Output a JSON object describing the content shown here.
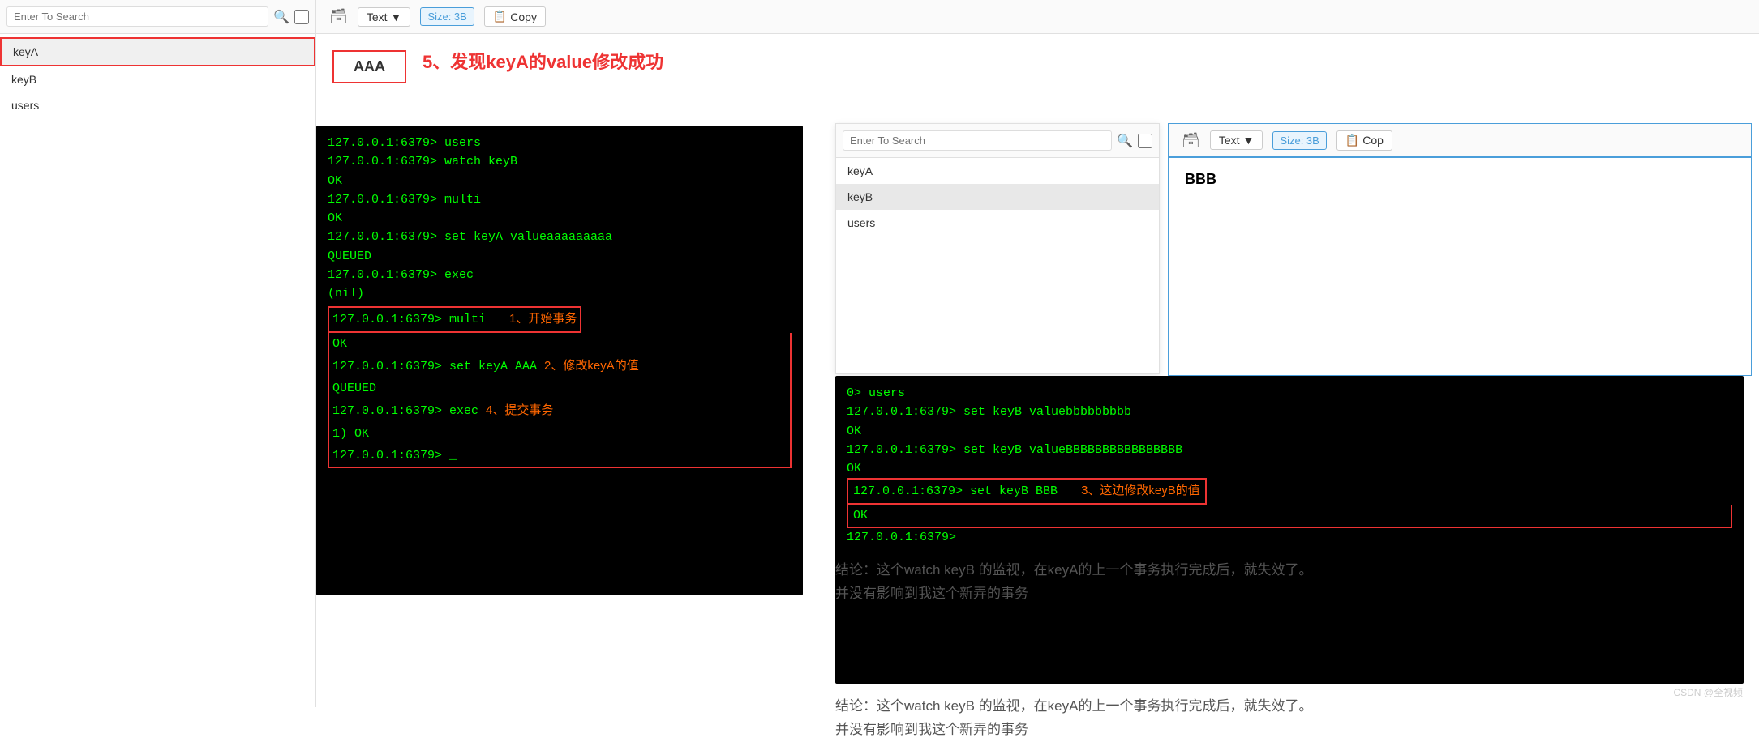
{
  "left_panel": {
    "search_placeholder": "Enter To Search",
    "keys": [
      {
        "label": "keyA",
        "selected": true
      },
      {
        "label": "keyB",
        "selected": false
      },
      {
        "label": "users",
        "selected": false
      }
    ]
  },
  "top_toolbar": {
    "type_label": "Text",
    "size_label": "Size: 3B",
    "copy_label": "Copy"
  },
  "main": {
    "value": "AAA",
    "title": "5、发现keyA的value修改成功"
  },
  "terminal_left": {
    "lines": [
      {
        "text": "127.0.0.1:6379> users",
        "color": "green"
      },
      {
        "text": "127.0.0.1:6379> watch keyB",
        "color": "green"
      },
      {
        "text": "OK",
        "color": "green"
      },
      {
        "text": "127.0.0.1:6379> multi",
        "color": "green"
      },
      {
        "text": "OK",
        "color": "green"
      },
      {
        "text": "127.0.0.1:6379> set keyA valueaaaaaaaaa",
        "color": "green"
      },
      {
        "text": "QUEUED",
        "color": "green"
      },
      {
        "text": "127.0.0.1:6379> exec",
        "color": "green"
      },
      {
        "text": "(nil)",
        "color": "green"
      },
      {
        "text": "127.0.0.1:6379> multi",
        "color": "green",
        "annotation": "1、开始事务"
      },
      {
        "text": "OK",
        "color": "green"
      },
      {
        "text": "127.0.0.1:6379> set keyA AAA",
        "color": "green",
        "annotation": "2、修改keyA的值"
      },
      {
        "text": "QUEUED",
        "color": "green"
      },
      {
        "text": "127.0.0.1:6379> exec",
        "color": "green",
        "annotation": "4、提交事务"
      },
      {
        "text": "1) OK",
        "color": "green"
      },
      {
        "text": "127.0.0.1:6379> _",
        "color": "green"
      }
    ]
  },
  "second_panel": {
    "search_placeholder": "Enter To Search",
    "keys": [
      {
        "label": "keyA",
        "selected": false
      },
      {
        "label": "keyB",
        "selected": true
      },
      {
        "label": "users",
        "selected": false
      }
    ],
    "toolbar": {
      "type_label": "Text",
      "size_label": "Size: 3B",
      "copy_label": "Cop"
    },
    "value": "BBB"
  },
  "terminal_right": {
    "lines": [
      {
        "text": "0> users",
        "color": "green"
      },
      {
        "text": "127.0.0.1:6379> set keyB valuebbbbbbbbb",
        "color": "green"
      },
      {
        "text": "OK",
        "color": "green"
      },
      {
        "text": "127.0.0.1:6379> set keyB valueBBBBBBBBBBBBBBBB",
        "color": "green"
      },
      {
        "text": "OK",
        "color": "green"
      },
      {
        "text": "127.0.0.1:6379> set keyB BBB",
        "color": "green",
        "annotation": "3、这边修改keyB的值",
        "boxed": true
      },
      {
        "text": "OK",
        "color": "green"
      },
      {
        "text": "127.0.0.1:6379>",
        "color": "green"
      }
    ]
  },
  "conclusion": {
    "line1": "结论：这个watch keyB 的监视，在keyA的上一个事务执行完成后，就失效了。",
    "line2": "并没有影响到我这个新弄的事务"
  },
  "watermark": "CSDN @全视频"
}
